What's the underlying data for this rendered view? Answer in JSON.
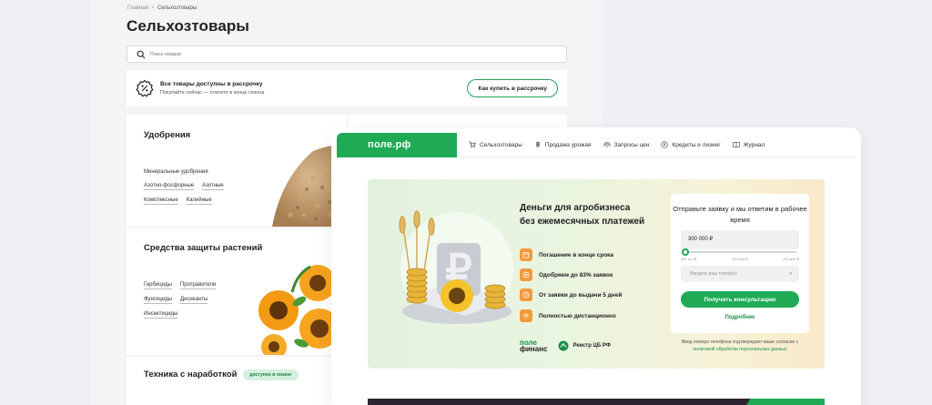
{
  "breadcrumb": {
    "home": "Главная",
    "separator": "•",
    "current": "Сельхозтовары"
  },
  "page_title": "Сельхозтовары",
  "search": {
    "placeholder": "Поиск товаров",
    "icon": "search-icon"
  },
  "promo": {
    "icon": "percent-badge-icon",
    "title": "Все товары доступны в рассрочку",
    "subtitle": "Покупайте сейчас — платите в конце сезона",
    "button": "Как купить в рассрочку"
  },
  "categories": [
    {
      "title": "Удобрения",
      "links": [
        "Минеральные удобрения",
        "Азотно-фосфорные",
        "Азотные",
        "Комплексные",
        "Калийные"
      ]
    },
    {
      "title": "Средства защиты растений",
      "links": [
        "Гербициды",
        "Протравители",
        "Фунгициды",
        "Десиканты",
        "Инсектициды"
      ]
    },
    {
      "title": "Техника с наработкой",
      "badge": "доступно в лизинг",
      "links": []
    }
  ],
  "front": {
    "logo": "поле.рф",
    "nav": [
      {
        "label": "Сельхозтовары",
        "icon": "cart-icon"
      },
      {
        "label": "Продажа урожая",
        "icon": "wheat-icon"
      },
      {
        "label": "Запросы цен",
        "icon": "scale-icon"
      },
      {
        "label": "Кредиты и лизинг",
        "icon": "coin-icon"
      },
      {
        "label": "Журнал",
        "icon": "book-icon"
      }
    ],
    "hero": {
      "title": "Деньги для агробизнеса без ежемесячных платежей",
      "features": [
        {
          "text": "Погашение в конце срока",
          "icon": "calendar-icon"
        },
        {
          "text": "Одобряем до 83% заявок",
          "icon": "target-icon"
        },
        {
          "text": "От заявки до выдачи 5 дней",
          "icon": "clock-icon"
        },
        {
          "text": "Полностью дистанционно",
          "icon": "wifi-icon"
        }
      ],
      "brand_line1": "поле",
      "brand_line2": "финанс",
      "registry": "Реестр ЦБ РФ",
      "accent": "#1faa56",
      "feature_color": "#f29a3c"
    },
    "form": {
      "title": "Отправьте заявку и мы ответим в рабочее время",
      "amount": "300 000 ₽",
      "slider_level": 0.0,
      "ticks": [
        "300 тыс ₽",
        "100 млн ₽",
        "200 млн ₽"
      ],
      "phone_placeholder": "Введите ваш телефон",
      "phone_dropdown": "▾",
      "cta": "Получить консультацию",
      "more": "Подробнее",
      "consent_text": "Ввод номера телефона подтверждает ваше согласие с",
      "consent_link": "политикой обработки персональных данных"
    }
  }
}
